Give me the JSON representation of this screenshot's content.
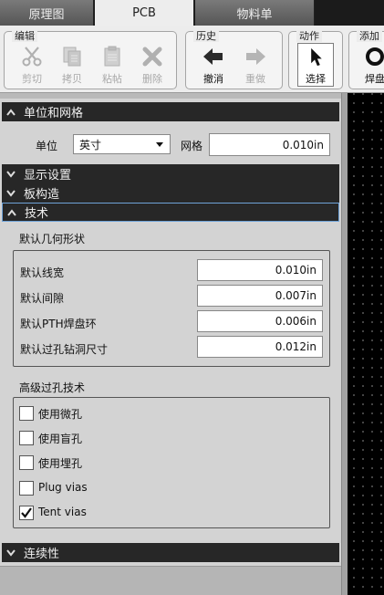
{
  "tabs": [
    {
      "label": "原理图"
    },
    {
      "label": "PCB"
    },
    {
      "label": "物料单"
    }
  ],
  "ribbon": {
    "edit": {
      "title": "编辑",
      "cut": "剪切",
      "copy": "拷贝",
      "paste": "粘帖",
      "delete": "删除"
    },
    "history": {
      "title": "历史",
      "undo": "撤消",
      "redo": "重做"
    },
    "action": {
      "title": "动作",
      "select": "选择"
    },
    "add": {
      "title": "添加",
      "pad": "焊盘"
    }
  },
  "units_grid": {
    "header": "单位和网格",
    "unit_label": "单位",
    "unit_value": "英寸",
    "grid_label": "网格",
    "grid_value": "0.010in"
  },
  "sections": {
    "display": "显示设置",
    "board": "板构造",
    "tech": "技术",
    "continuity": "连续性"
  },
  "geometry": {
    "title": "默认几何形状",
    "rows": [
      {
        "label": "默认线宽",
        "value": "0.010in"
      },
      {
        "label": "默认间隙",
        "value": "0.007in"
      },
      {
        "label": "默认PTH焊盘环",
        "value": "0.006in"
      },
      {
        "label": "默认过孔钻洞尺寸",
        "value": "0.012in"
      }
    ]
  },
  "vias": {
    "title": "高级过孔技术",
    "options": [
      {
        "label": "使用微孔",
        "checked": false
      },
      {
        "label": "使用盲孔",
        "checked": false
      },
      {
        "label": "使用埋孔",
        "checked": false
      },
      {
        "label": "Plug vias",
        "checked": false
      },
      {
        "label": "Tent vias",
        "checked": true
      }
    ]
  },
  "colors": {
    "header_bg": "#272727",
    "panel_bg": "#d3d3d3",
    "active_border": "#6fa3d8",
    "canvas_bg": "#000000"
  }
}
